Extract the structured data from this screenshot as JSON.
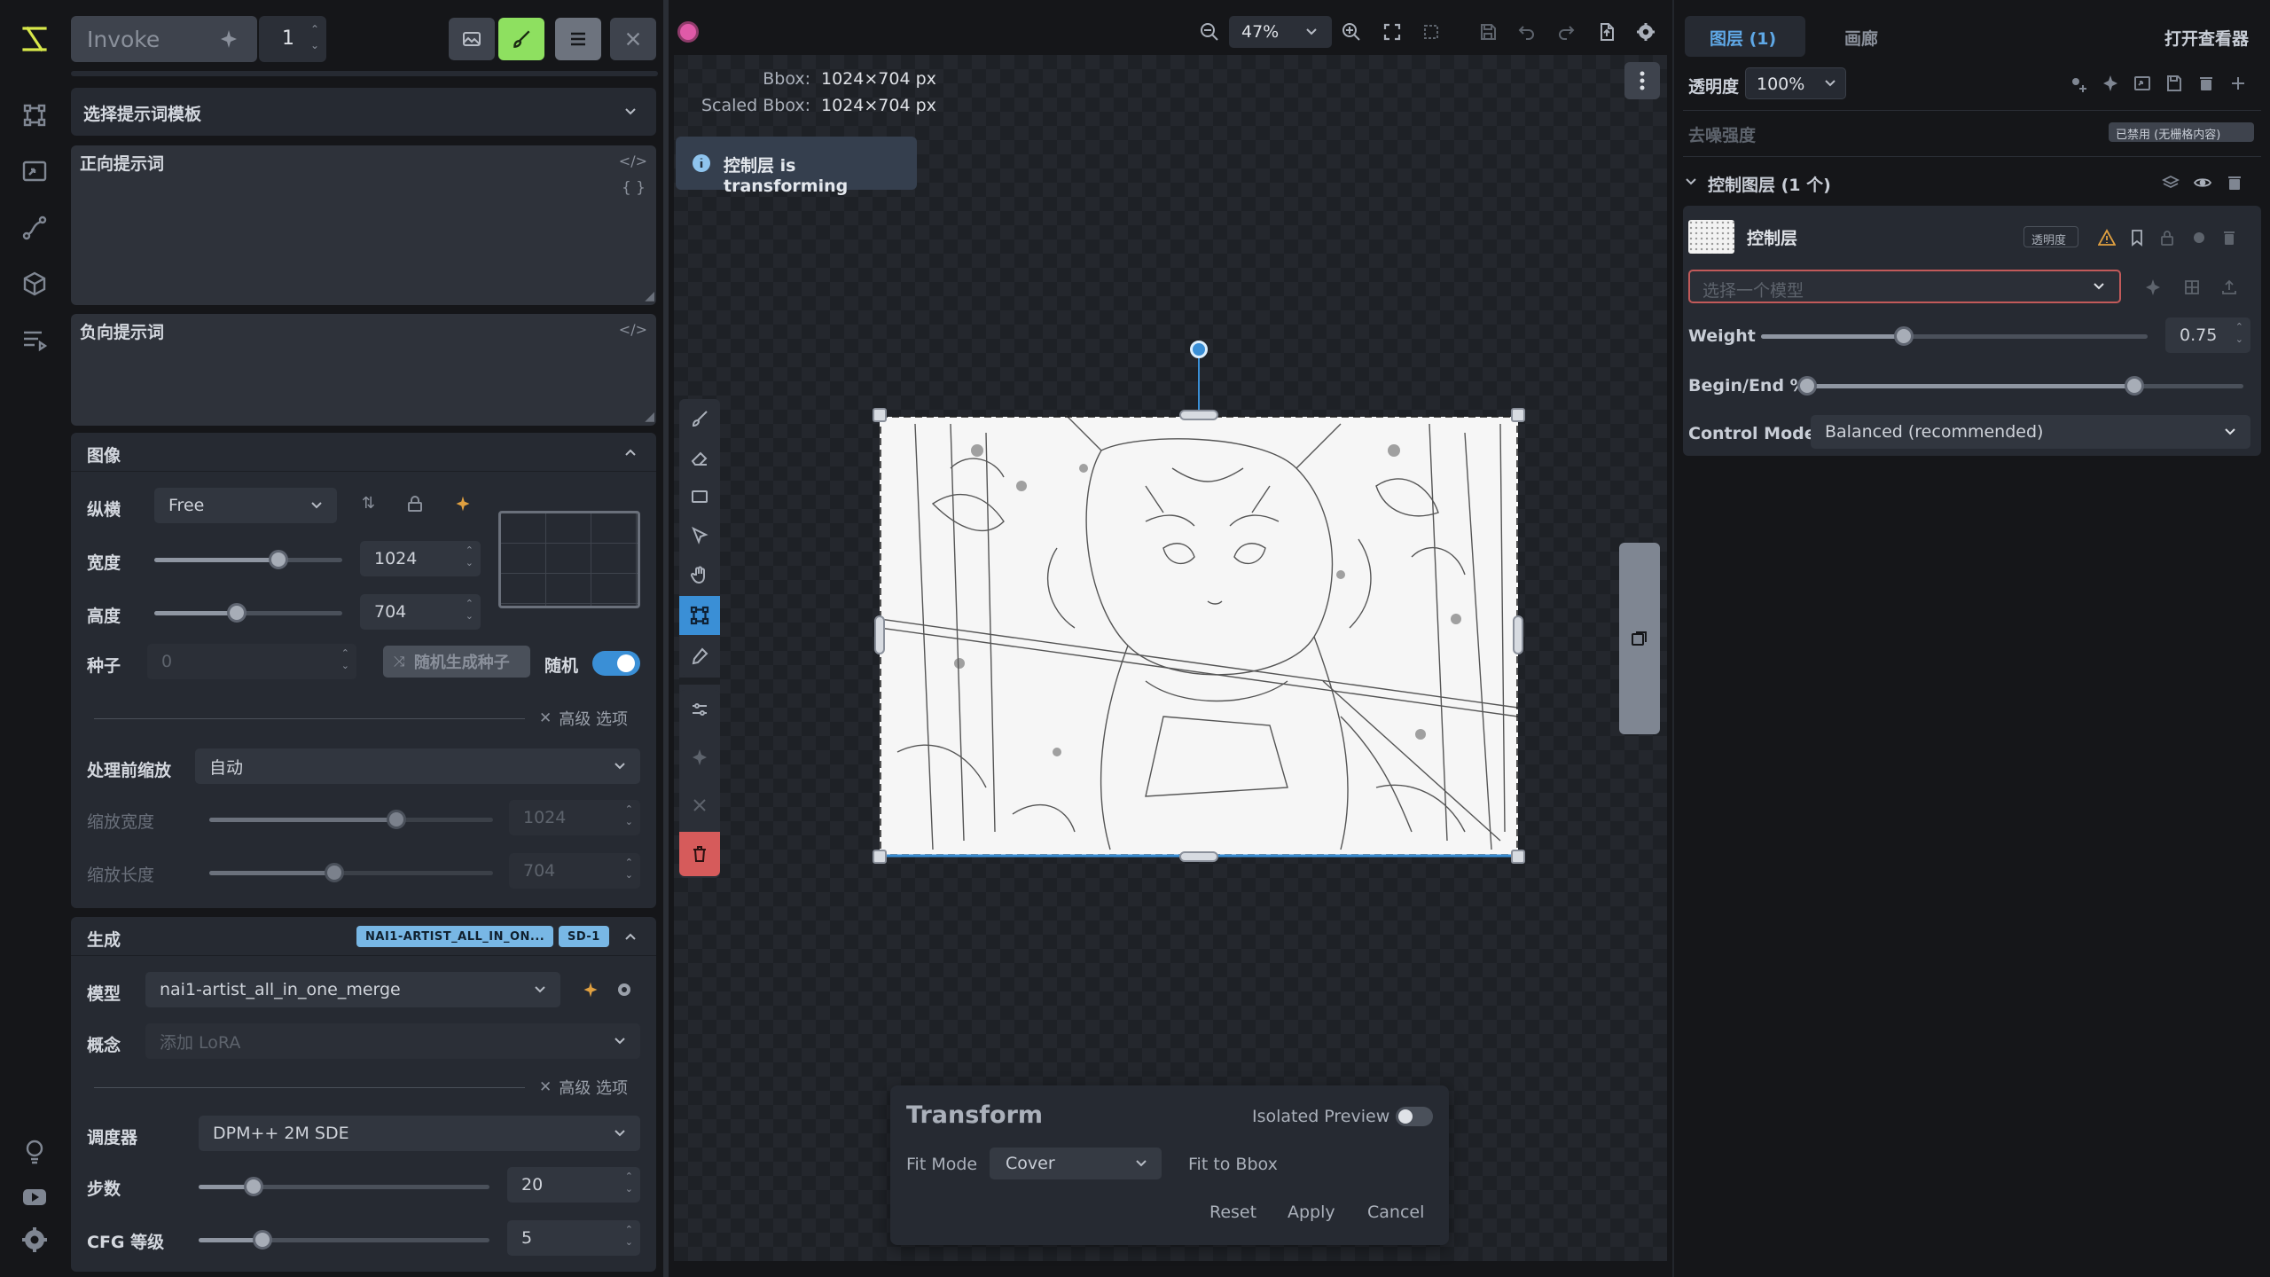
{
  "app": {
    "name": "Invoke",
    "iterations": "1"
  },
  "prompts": {
    "template_label": "选择提示词模板",
    "positive_label": "正向提示词",
    "negative_label": "负向提示词"
  },
  "image_section": {
    "title": "图像",
    "aspect_label": "纵横",
    "aspect_value": "Free",
    "width_label": "宽度",
    "width_value": "1024",
    "width_fraction": 0.66,
    "height_label": "高度",
    "height_value": "704",
    "height_fraction": 0.44,
    "seed_label": "种子",
    "seed_value": "0",
    "random_seed_button": "随机生成种子",
    "random_label": "随机",
    "advanced_label": "高级 选项",
    "scale_before_label": "处理前缩放",
    "scale_before_value": "自动",
    "scaled_width_label": "缩放宽度",
    "scaled_width_value": "1024",
    "scaled_width_fraction": 0.66,
    "scaled_height_label": "缩放长度",
    "scaled_height_value": "704",
    "scaled_height_fraction": 0.44
  },
  "generation_section": {
    "title": "生成",
    "badge_model": "NAI1-ARTIST_ALL_IN_ON...",
    "badge_base": "SD-1",
    "model_label": "模型",
    "model_value": "nai1-artist_all_in_one_merge",
    "concept_label": "概念",
    "concept_placeholder": "添加 LoRA",
    "advanced_label": "高级 选项",
    "scheduler_label": "调度器",
    "scheduler_value": "DPM++ 2M SDE",
    "steps_label": "步数",
    "steps_value": "20",
    "steps_fraction": 0.19,
    "cfg_label": "CFG 等级",
    "cfg_value": "5",
    "cfg_fraction": 0.22
  },
  "canvas_toolbar": {
    "zoom_value": "47%"
  },
  "canvas_info": {
    "bbox_label": "Bbox:",
    "bbox_value": "1024×704 px",
    "scaled_bbox_label": "Scaled Bbox:",
    "scaled_bbox_value": "1024×704 px"
  },
  "toast": {
    "message": "控制层 is transforming"
  },
  "transform_panel": {
    "title": "Transform",
    "isolated_preview_label": "Isolated Preview",
    "fit_mode_label": "Fit Mode",
    "fit_mode_value": "Cover",
    "fit_to_bbox_button": "Fit to Bbox",
    "reset_button": "Reset",
    "apply_button": "Apply",
    "cancel_button": "Cancel"
  },
  "right_panel": {
    "tab_layers": "图层 (1)",
    "tab_gallery": "画廊",
    "open_viewer": "打开查看器",
    "opacity_label": "透明度",
    "opacity_value": "100%",
    "denoise_label": "去噪强度",
    "denoise_status": "已禁用 (无栅格内容)",
    "control_layers_header": "控制图层 (1 个)",
    "layer_name": "控制层",
    "layer_opacity_badge": "透明度",
    "model_placeholder": "选择一个模型",
    "weight_label": "Weight",
    "weight_value": "0.75",
    "weight_fraction": 0.37,
    "begin_end_label": "Begin/End %",
    "begin_fraction": 0.0,
    "end_fraction": 0.75,
    "control_mode_label": "Control Mode",
    "control_mode_value": "Balanced (recommended)"
  },
  "colors": {
    "accent_green": "#9ee86b",
    "accent_blue": "#3a8fd6",
    "delete_red": "#d65b5b",
    "warning_orange": "#e0a040",
    "badge_blue": "#78b7e5"
  }
}
